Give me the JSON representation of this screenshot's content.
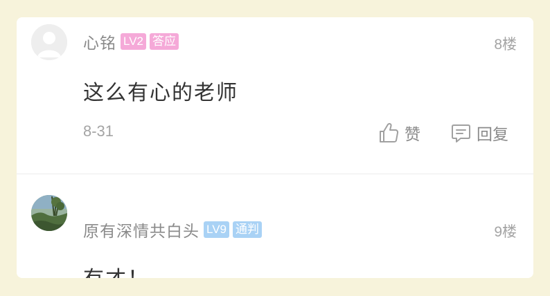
{
  "comments": [
    {
      "username": "心铭",
      "level": "LV2",
      "title": "答应",
      "floor": "8楼",
      "content": "这么有心的老师",
      "date": "8-31",
      "like_label": "赞",
      "reply_label": "回复",
      "badge_color": "#f5a9d8"
    },
    {
      "username": "原有深情共白头",
      "level": "LV9",
      "title": "通判",
      "floor": "9楼",
      "content": "有才！",
      "badge_color": "#a9d2f5"
    }
  ],
  "colors": {
    "background": "#f7f3db",
    "card": "#ffffff",
    "text_primary": "#333333",
    "text_secondary": "#8a8a8a",
    "text_muted": "#a4a4a4"
  },
  "icons": {
    "like": "thumbs-up-icon",
    "reply": "comment-bubble-icon"
  }
}
